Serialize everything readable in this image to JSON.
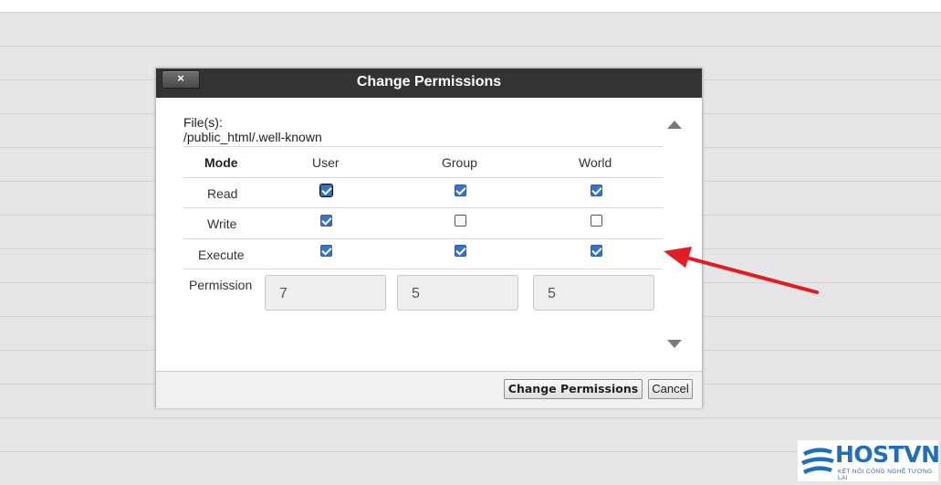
{
  "dialog": {
    "title": "Change Permissions",
    "close_label": "×",
    "files_label": "File(s):",
    "files_path": "/public_html/.well-known"
  },
  "table": {
    "headers": [
      "Mode",
      "User",
      "Group",
      "World"
    ],
    "rows": [
      {
        "label": "Read",
        "user": true,
        "group": true,
        "world": true
      },
      {
        "label": "Write",
        "user": true,
        "group": false,
        "world": false
      },
      {
        "label": "Execute",
        "user": true,
        "group": true,
        "world": true
      }
    ],
    "permission_label": "Permission",
    "permission_values": [
      "7",
      "5",
      "5"
    ]
  },
  "footer": {
    "change_button": "Change Permissions",
    "cancel_button": "Cancel"
  },
  "logo": {
    "name": "HOSTVN",
    "tagline": "KẾT NỐI CÔNG NGHỆ TƯƠNG LAI"
  },
  "colors": {
    "header_bg": "#333333",
    "checkbox_accent": "#3b72c7",
    "arrow": "#e31b23",
    "logo_blue": "#1f6fbf"
  }
}
